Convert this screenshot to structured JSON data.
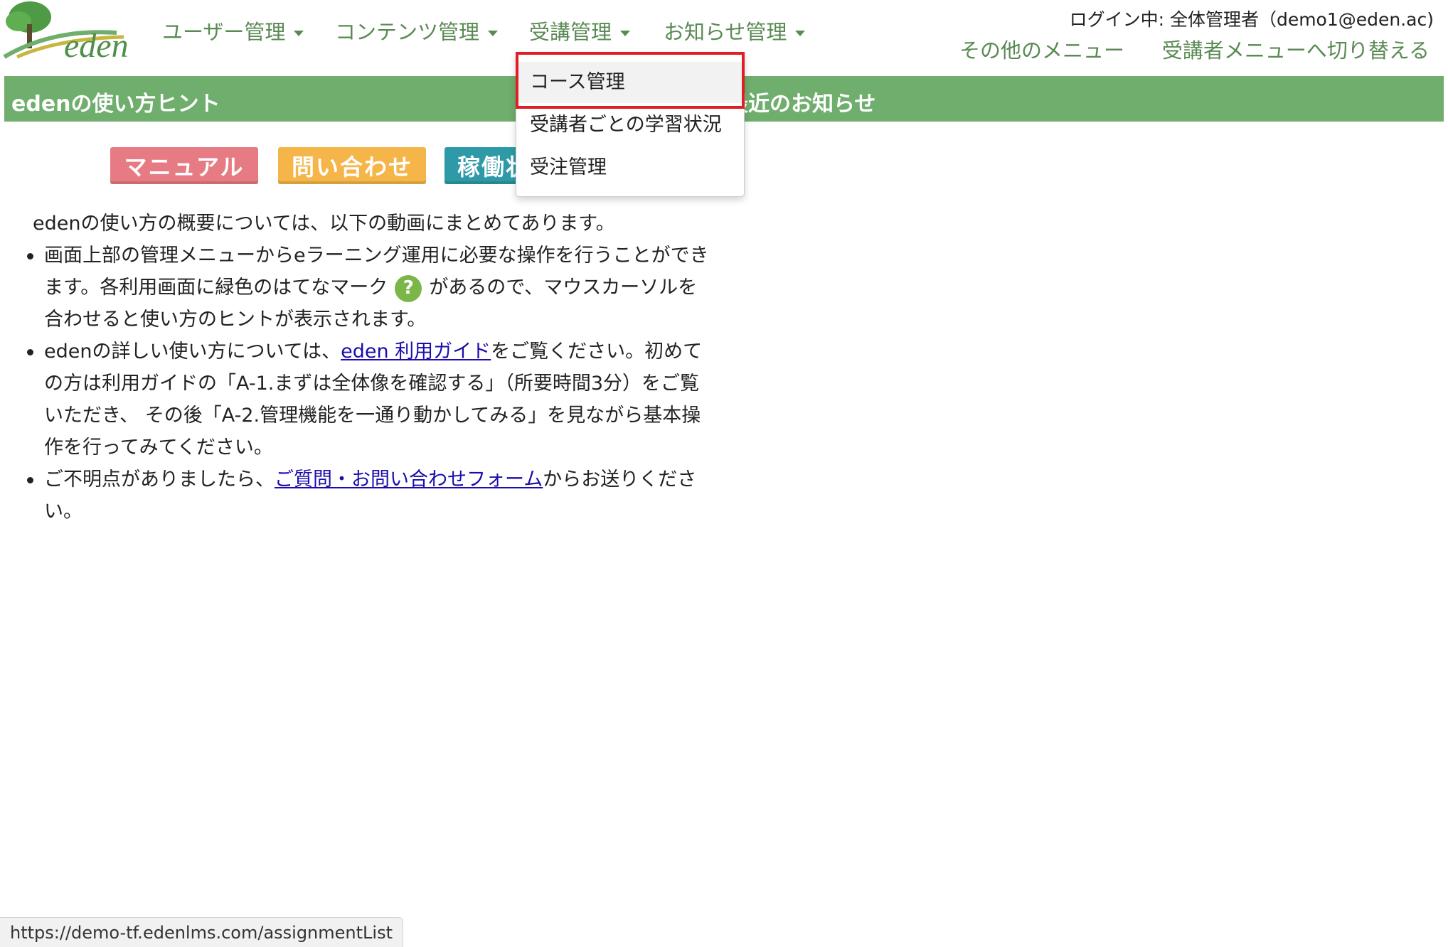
{
  "header": {
    "logo_text": "eden",
    "nav": [
      {
        "label": "ユーザー管理"
      },
      {
        "label": "コンテンツ管理"
      },
      {
        "label": "受講管理"
      },
      {
        "label": "お知らせ管理"
      }
    ],
    "login_info": "ログイン中: 全体管理者（demo1@eden.ac)",
    "other_menu": "その他のメニュー",
    "switch_menu": "受講者メニューへ切り替える"
  },
  "bar": {
    "left_title": "edenの使い方ヒント",
    "right_title": "最近のお知らせ"
  },
  "buttons": {
    "manual": "マニュアル",
    "inquiry": "問い合わせ",
    "status": "稼働状"
  },
  "content": {
    "intro": "edenの使い方の概要については、以下の動画にまとめてあります。",
    "hint1_part1": "画面上部の管理メニューからeラーニング運用に必要な操作を行うことができます。各利用画面に緑色のはてなマーク",
    "hint1_qmark": "?",
    "hint1_part2": "があるので、マウスカーソルを合わせると使い方のヒントが表示されます。",
    "hint2_part1": "edenの詳しい使い方については、",
    "hint2_link": "eden 利用ガイド",
    "hint2_part2": "をご覧ください。初めての方は利用ガイドの「A-1.まずは全体像を確認する」（所要時間3分）をご覧いただき、 その後「A-2.管理機能を一通り動かしてみる」を見ながら基本操作を行ってみてください。",
    "hint3_part1": "ご不明点がありましたら、",
    "hint3_link": "ご質問・お問い合わせフォーム",
    "hint3_part2": "からお送りください。"
  },
  "dropdown": {
    "items": [
      {
        "label": "コース管理"
      },
      {
        "label": "受講者ごとの学習状況"
      },
      {
        "label": "受注管理"
      }
    ]
  },
  "status_bar": {
    "url": "https://demo-tf.edenlms.com/assignmentList"
  },
  "colors": {
    "nav_green": "#5a8a53",
    "bar_green": "#6fae6c",
    "highlight_red": "#e01e26"
  }
}
